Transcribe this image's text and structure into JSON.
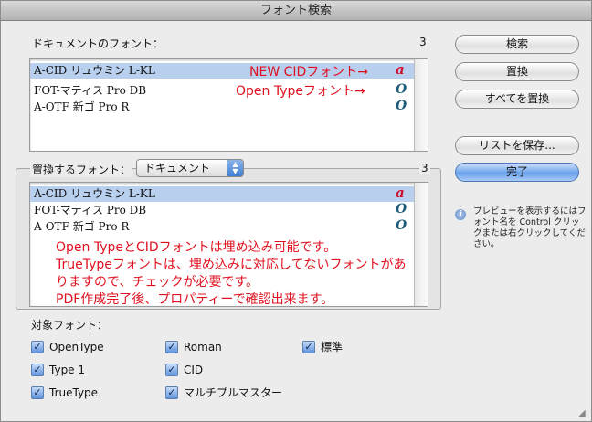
{
  "window": {
    "title": "フォント検索"
  },
  "document_fonts": {
    "label": "ドキュメントのフォント：",
    "count": "3",
    "rows": [
      {
        "name": "A-CID リュウミン L-KL",
        "icon": "cid-font-icon",
        "icon_glyph": "a"
      },
      {
        "name": "FOT-マティス Pro DB",
        "icon": "opentype-font-icon",
        "icon_glyph": "O"
      },
      {
        "name": "A-OTF 新ゴ Pro R",
        "icon": "opentype-font-icon",
        "icon_glyph": "O"
      }
    ],
    "annotations": [
      "NEW CIDフォント→",
      "Open Typeフォント→"
    ]
  },
  "replace_fonts": {
    "label": "置換するフォント：",
    "popup_value": "ドキュメント",
    "count": "3",
    "rows": [
      {
        "name": "A-CID リュウミン L-KL",
        "icon": "cid-font-icon",
        "icon_glyph": "a"
      },
      {
        "name": "FOT-マティス Pro DB",
        "icon": "opentype-font-icon",
        "icon_glyph": "O"
      },
      {
        "name": "A-OTF 新ゴ Pro R",
        "icon": "opentype-font-icon",
        "icon_glyph": "O"
      }
    ],
    "notes": [
      "Open TypeとCIDフォントは埋め込み可能です。",
      "TrueTypeフォントは、埋め込みに対応してないフォントがあ",
      "りますので、チェックが必要です。",
      "PDF作成完了後、プロパティーで確認出来ます。"
    ]
  },
  "target_fonts": {
    "label": "対象フォント：",
    "checkboxes": [
      {
        "label": "OpenType",
        "checked": true
      },
      {
        "label": "Roman",
        "checked": true
      },
      {
        "label": "標準",
        "checked": true
      },
      {
        "label": "Type 1",
        "checked": true
      },
      {
        "label": "CID",
        "checked": true
      },
      {
        "label": "TrueType",
        "checked": true
      },
      {
        "label": "マルチプルマスター",
        "checked": true
      }
    ]
  },
  "buttons": {
    "search": "検索",
    "replace": "置換",
    "replace_all": "すべてを置換",
    "save_list": "リストを保存...",
    "done": "完了"
  },
  "info": {
    "text": "プレビューを表示するにはフォント名を Control クリックまたは右クリックしてください。"
  },
  "colors": {
    "selection": "#b8cfee",
    "annotation": "#e0111f",
    "cid_icon": "#d0102a",
    "opentype_icon": "#1d5b7a"
  }
}
